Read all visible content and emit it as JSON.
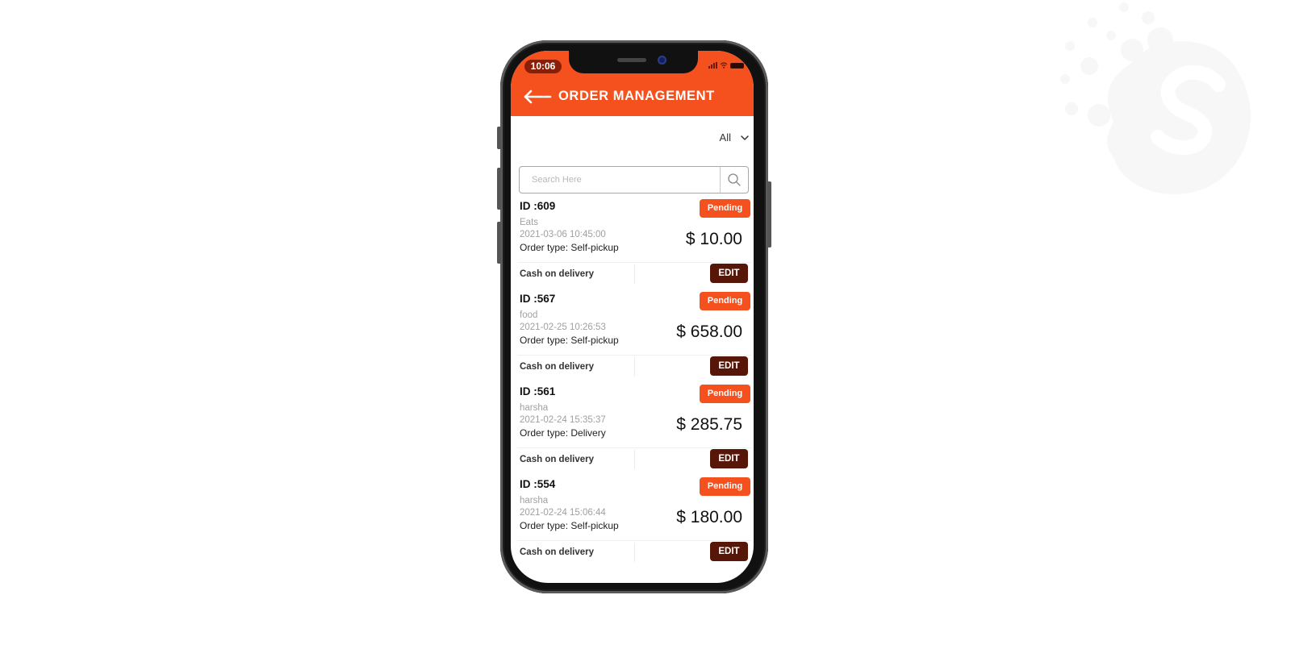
{
  "status_bar": {
    "time": "10:06"
  },
  "header": {
    "title": "ORDER MANAGEMENT"
  },
  "filter": {
    "selected": "All"
  },
  "search": {
    "placeholder": "Search Here",
    "value": ""
  },
  "colors": {
    "accent": "#f4511e",
    "edit_button": "#561608",
    "time_pill": "#8a1f07"
  },
  "orders": [
    {
      "id": "ID :609",
      "status": "Pending",
      "customer": "Eats",
      "datetime": "2021-03-06  10:45:00",
      "order_type": "Order type: Self-pickup",
      "amount": "$ 10.00",
      "payment": "Cash on delivery",
      "edit_label": "EDIT"
    },
    {
      "id": "ID :567",
      "status": "Pending",
      "customer": "food",
      "datetime": "2021-02-25  10:26:53",
      "order_type": "Order type: Self-pickup",
      "amount": "$ 658.00",
      "payment": "Cash on delivery",
      "edit_label": "EDIT"
    },
    {
      "id": "ID :561",
      "status": "Pending",
      "customer": "harsha",
      "datetime": "2021-02-24  15:35:37",
      "order_type": "Order type: Delivery",
      "amount": "$ 285.75",
      "payment": "Cash on delivery",
      "edit_label": "EDIT"
    },
    {
      "id": "ID :554",
      "status": "Pending",
      "customer": "harsha",
      "datetime": "2021-02-24  15:06:44",
      "order_type": "Order type: Self-pickup",
      "amount": "$ 180.00",
      "payment": "Cash on delivery",
      "edit_label": "EDIT"
    }
  ]
}
